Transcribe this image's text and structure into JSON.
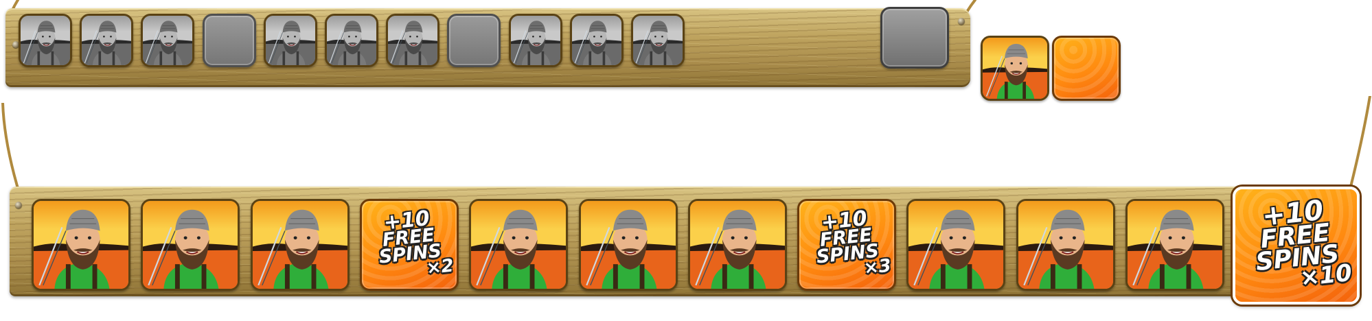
{
  "top_row": {
    "tiles": [
      "fisherman-gray",
      "fisherman-gray",
      "fisherman-gray",
      "empty",
      "fisherman-gray",
      "fisherman-gray",
      "fisherman-gray",
      "empty",
      "fisherman-gray",
      "fisherman-gray",
      "fisherman-gray"
    ],
    "end_tile": "empty-large"
  },
  "samples": [
    "fisherman-color",
    "orange-blank"
  ],
  "bottom_row": {
    "tiles": [
      {
        "kind": "fisherman"
      },
      {
        "kind": "fisherman"
      },
      {
        "kind": "fisherman"
      },
      {
        "kind": "bonus",
        "line1": "+10",
        "line2": "FREE",
        "line3": "SPINS",
        "mult": "×2"
      },
      {
        "kind": "fisherman"
      },
      {
        "kind": "fisherman"
      },
      {
        "kind": "fisherman"
      },
      {
        "kind": "bonus",
        "line1": "+10",
        "line2": "FREE",
        "line3": "SPINS",
        "mult": "×3"
      },
      {
        "kind": "fisherman"
      },
      {
        "kind": "fisherman"
      },
      {
        "kind": "fisherman"
      }
    ],
    "end_tile": {
      "kind": "bonus-large",
      "line1": "+10",
      "line2": "FREE",
      "line3": "SPINS",
      "mult": "×10"
    }
  },
  "colors": {
    "wood": "#bfa45f",
    "sunset_orange": "#f6a21a",
    "bonus_orange": "#ff8a10",
    "shirt_green": "#2fae3a",
    "beard_brown": "#5a3a22",
    "rope": "#b08a3e"
  }
}
